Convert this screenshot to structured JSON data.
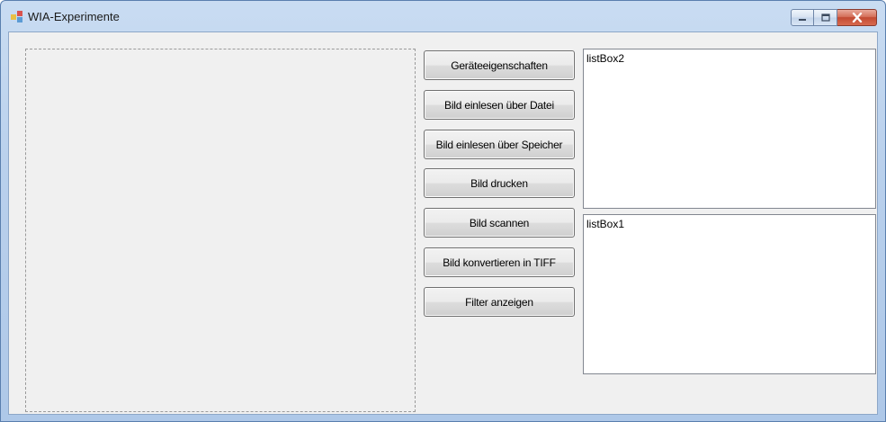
{
  "window": {
    "title": "WIA-Experimente"
  },
  "buttons": [
    {
      "label": "Geräteeigenschaften"
    },
    {
      "label": "Bild einlesen über Datei"
    },
    {
      "label": "Bild einlesen über Speicher"
    },
    {
      "label": "Bild drucken"
    },
    {
      "label": "Bild scannen"
    },
    {
      "label": "Bild konvertieren in TIFF"
    },
    {
      "label": "Filter anzeigen"
    }
  ],
  "listbox_top": {
    "items": [
      "listBox2"
    ]
  },
  "listbox_bottom": {
    "items": [
      "listBox1"
    ]
  },
  "colors": {
    "titlebar": "#b9d0ec",
    "client_background": "#f0f0f0",
    "close_button": "#c24a33"
  },
  "icons": [
    "app-icon",
    "minimize-icon",
    "maximize-icon",
    "close-icon"
  ]
}
